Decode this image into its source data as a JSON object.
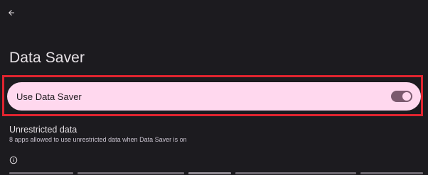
{
  "header": {
    "back_icon": "arrow-back-icon"
  },
  "page": {
    "title": "Data Saver"
  },
  "data_saver": {
    "label": "Use Data Saver",
    "enabled": true
  },
  "unrestricted": {
    "title": "Unrestricted data",
    "summary": "8 apps allowed to use unrestricted data when Data Saver is on"
  },
  "footer": {
    "info_icon": "info-icon"
  },
  "colors": {
    "background": "#1c1b1f",
    "highlight_row": "#ffd8ee",
    "toggle_track": "#7b5a6e",
    "annotation_frame": "#e0242f"
  }
}
